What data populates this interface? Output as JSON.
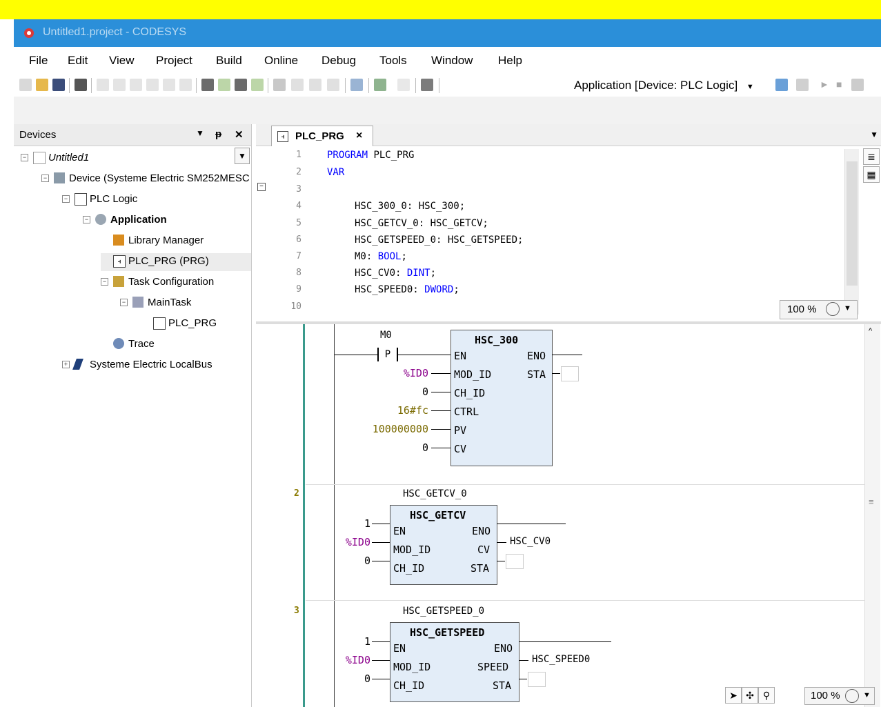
{
  "window": {
    "title": "Untitled1.project - CODESYS"
  },
  "menu": [
    "File",
    "Edit",
    "View",
    "Project",
    "Build",
    "Online",
    "Debug",
    "Tools",
    "Window",
    "Help"
  ],
  "toolbar": {
    "application_selector": "Application [Device: PLC Logic]"
  },
  "devices_panel": {
    "title": "Devices",
    "tree": [
      {
        "label": "Untitled1",
        "icon": "project-icon"
      },
      {
        "label": "Device (Systeme Electric SM252MESC",
        "icon": "device-icon"
      },
      {
        "label": "PLC Logic",
        "icon": "plc-logic-icon"
      },
      {
        "label": "Application",
        "icon": "application-gear-icon"
      },
      {
        "label": "Library Manager",
        "icon": "library-icon"
      },
      {
        "label": "PLC_PRG (PRG)",
        "icon": "program-icon"
      },
      {
        "label": "Task Configuration",
        "icon": "task-config-icon"
      },
      {
        "label": "MainTask",
        "icon": "task-icon"
      },
      {
        "label": "PLC_PRG",
        "icon": "program-call-icon"
      },
      {
        "label": "Trace",
        "icon": "trace-icon"
      },
      {
        "label": "Systeme Electric LocalBus",
        "icon": "bus-icon"
      }
    ]
  },
  "editor": {
    "tab_label": "PLC_PRG",
    "line_numbers": [
      "1",
      "2",
      "3",
      "4",
      "5",
      "6",
      "7",
      "8",
      "9",
      "10"
    ],
    "decl": {
      "l1_kw": "PROGRAM",
      "l1_rest": " PLC_PRG",
      "l2_kw": "VAR",
      "l4": "HSC_300_0: HSC_300;",
      "l5": "HSC_GETCV_0: HSC_GETCV;",
      "l6": "HSC_GETSPEED_0: HSC_GETSPEED;",
      "l7_name": "M0: ",
      "l7_type": "BOOL",
      "l7_semi": ";",
      "l8_name": "HSC_CV0: ",
      "l8_type": "DINT",
      "l8_semi": ";",
      "l9_name": "HSC_SPEED0: ",
      "l9_type": "DWORD",
      "l9_semi": ";"
    },
    "zoom_decl": "100 %",
    "zoom_ladder": "100 %"
  },
  "ladder": {
    "rung1": {
      "contact_var": "M0",
      "contact_type": "P",
      "fb_type": "HSC_300",
      "inputs": [
        {
          "pin": "EN",
          "value": ""
        },
        {
          "pin": "MOD_ID",
          "value": "%ID0"
        },
        {
          "pin": "CH_ID",
          "value": "0"
        },
        {
          "pin": "CTRL",
          "value": "16#fc"
        },
        {
          "pin": "PV",
          "value": "100000000"
        },
        {
          "pin": "CV",
          "value": "0"
        }
      ],
      "outputs": [
        {
          "pin": "ENO"
        },
        {
          "pin": "STA"
        }
      ]
    },
    "rung2": {
      "number": "2",
      "instance": "HSC_GETCV_0",
      "fb_type": "HSC_GETCV",
      "inputs": [
        {
          "pin": "EN",
          "value": "1"
        },
        {
          "pin": "MOD_ID",
          "value": "%ID0"
        },
        {
          "pin": "CH_ID",
          "value": "0"
        }
      ],
      "outputs": [
        {
          "pin": "ENO",
          "value": ""
        },
        {
          "pin": "CV",
          "value": "HSC_CV0"
        },
        {
          "pin": "STA",
          "value": ""
        }
      ]
    },
    "rung3": {
      "number": "3",
      "instance": "HSC_GETSPEED_0",
      "fb_type": "HSC_GETSPEED",
      "inputs": [
        {
          "pin": "EN",
          "value": "1"
        },
        {
          "pin": "MOD_ID",
          "value": "%ID0"
        },
        {
          "pin": "CH_ID",
          "value": "0"
        }
      ],
      "outputs": [
        {
          "pin": "ENO",
          "value": ""
        },
        {
          "pin": "SPEED",
          "value": "HSC_SPEED0"
        },
        {
          "pin": "STA",
          "value": ""
        }
      ]
    }
  }
}
